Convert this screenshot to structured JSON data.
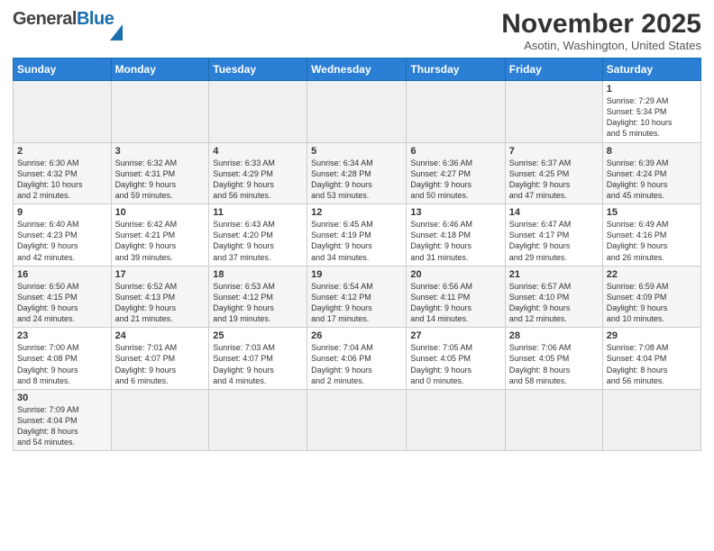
{
  "header": {
    "logo_general": "General",
    "logo_blue": "Blue",
    "month_title": "November 2025",
    "location": "Asotin, Washington, United States"
  },
  "weekdays": [
    "Sunday",
    "Monday",
    "Tuesday",
    "Wednesday",
    "Thursday",
    "Friday",
    "Saturday"
  ],
  "weeks": [
    [
      {
        "day": "",
        "info": ""
      },
      {
        "day": "",
        "info": ""
      },
      {
        "day": "",
        "info": ""
      },
      {
        "day": "",
        "info": ""
      },
      {
        "day": "",
        "info": ""
      },
      {
        "day": "",
        "info": ""
      },
      {
        "day": "1",
        "info": "Sunrise: 7:29 AM\nSunset: 5:34 PM\nDaylight: 10 hours\nand 5 minutes."
      }
    ],
    [
      {
        "day": "2",
        "info": "Sunrise: 6:30 AM\nSunset: 4:32 PM\nDaylight: 10 hours\nand 2 minutes."
      },
      {
        "day": "3",
        "info": "Sunrise: 6:32 AM\nSunset: 4:31 PM\nDaylight: 9 hours\nand 59 minutes."
      },
      {
        "day": "4",
        "info": "Sunrise: 6:33 AM\nSunset: 4:29 PM\nDaylight: 9 hours\nand 56 minutes."
      },
      {
        "day": "5",
        "info": "Sunrise: 6:34 AM\nSunset: 4:28 PM\nDaylight: 9 hours\nand 53 minutes."
      },
      {
        "day": "6",
        "info": "Sunrise: 6:36 AM\nSunset: 4:27 PM\nDaylight: 9 hours\nand 50 minutes."
      },
      {
        "day": "7",
        "info": "Sunrise: 6:37 AM\nSunset: 4:25 PM\nDaylight: 9 hours\nand 47 minutes."
      },
      {
        "day": "8",
        "info": "Sunrise: 6:39 AM\nSunset: 4:24 PM\nDaylight: 9 hours\nand 45 minutes."
      }
    ],
    [
      {
        "day": "9",
        "info": "Sunrise: 6:40 AM\nSunset: 4:23 PM\nDaylight: 9 hours\nand 42 minutes."
      },
      {
        "day": "10",
        "info": "Sunrise: 6:42 AM\nSunset: 4:21 PM\nDaylight: 9 hours\nand 39 minutes."
      },
      {
        "day": "11",
        "info": "Sunrise: 6:43 AM\nSunset: 4:20 PM\nDaylight: 9 hours\nand 37 minutes."
      },
      {
        "day": "12",
        "info": "Sunrise: 6:45 AM\nSunset: 4:19 PM\nDaylight: 9 hours\nand 34 minutes."
      },
      {
        "day": "13",
        "info": "Sunrise: 6:46 AM\nSunset: 4:18 PM\nDaylight: 9 hours\nand 31 minutes."
      },
      {
        "day": "14",
        "info": "Sunrise: 6:47 AM\nSunset: 4:17 PM\nDaylight: 9 hours\nand 29 minutes."
      },
      {
        "day": "15",
        "info": "Sunrise: 6:49 AM\nSunset: 4:16 PM\nDaylight: 9 hours\nand 26 minutes."
      }
    ],
    [
      {
        "day": "16",
        "info": "Sunrise: 6:50 AM\nSunset: 4:15 PM\nDaylight: 9 hours\nand 24 minutes."
      },
      {
        "day": "17",
        "info": "Sunrise: 6:52 AM\nSunset: 4:13 PM\nDaylight: 9 hours\nand 21 minutes."
      },
      {
        "day": "18",
        "info": "Sunrise: 6:53 AM\nSunset: 4:12 PM\nDaylight: 9 hours\nand 19 minutes."
      },
      {
        "day": "19",
        "info": "Sunrise: 6:54 AM\nSunset: 4:12 PM\nDaylight: 9 hours\nand 17 minutes."
      },
      {
        "day": "20",
        "info": "Sunrise: 6:56 AM\nSunset: 4:11 PM\nDaylight: 9 hours\nand 14 minutes."
      },
      {
        "day": "21",
        "info": "Sunrise: 6:57 AM\nSunset: 4:10 PM\nDaylight: 9 hours\nand 12 minutes."
      },
      {
        "day": "22",
        "info": "Sunrise: 6:59 AM\nSunset: 4:09 PM\nDaylight: 9 hours\nand 10 minutes."
      }
    ],
    [
      {
        "day": "23",
        "info": "Sunrise: 7:00 AM\nSunset: 4:08 PM\nDaylight: 9 hours\nand 8 minutes."
      },
      {
        "day": "24",
        "info": "Sunrise: 7:01 AM\nSunset: 4:07 PM\nDaylight: 9 hours\nand 6 minutes."
      },
      {
        "day": "25",
        "info": "Sunrise: 7:03 AM\nSunset: 4:07 PM\nDaylight: 9 hours\nand 4 minutes."
      },
      {
        "day": "26",
        "info": "Sunrise: 7:04 AM\nSunset: 4:06 PM\nDaylight: 9 hours\nand 2 minutes."
      },
      {
        "day": "27",
        "info": "Sunrise: 7:05 AM\nSunset: 4:05 PM\nDaylight: 9 hours\nand 0 minutes."
      },
      {
        "day": "28",
        "info": "Sunrise: 7:06 AM\nSunset: 4:05 PM\nDaylight: 8 hours\nand 58 minutes."
      },
      {
        "day": "29",
        "info": "Sunrise: 7:08 AM\nSunset: 4:04 PM\nDaylight: 8 hours\nand 56 minutes."
      }
    ],
    [
      {
        "day": "30",
        "info": "Sunrise: 7:09 AM\nSunset: 4:04 PM\nDaylight: 8 hours\nand 54 minutes."
      },
      {
        "day": "",
        "info": ""
      },
      {
        "day": "",
        "info": ""
      },
      {
        "day": "",
        "info": ""
      },
      {
        "day": "",
        "info": ""
      },
      {
        "day": "",
        "info": ""
      },
      {
        "day": "",
        "info": ""
      }
    ]
  ]
}
